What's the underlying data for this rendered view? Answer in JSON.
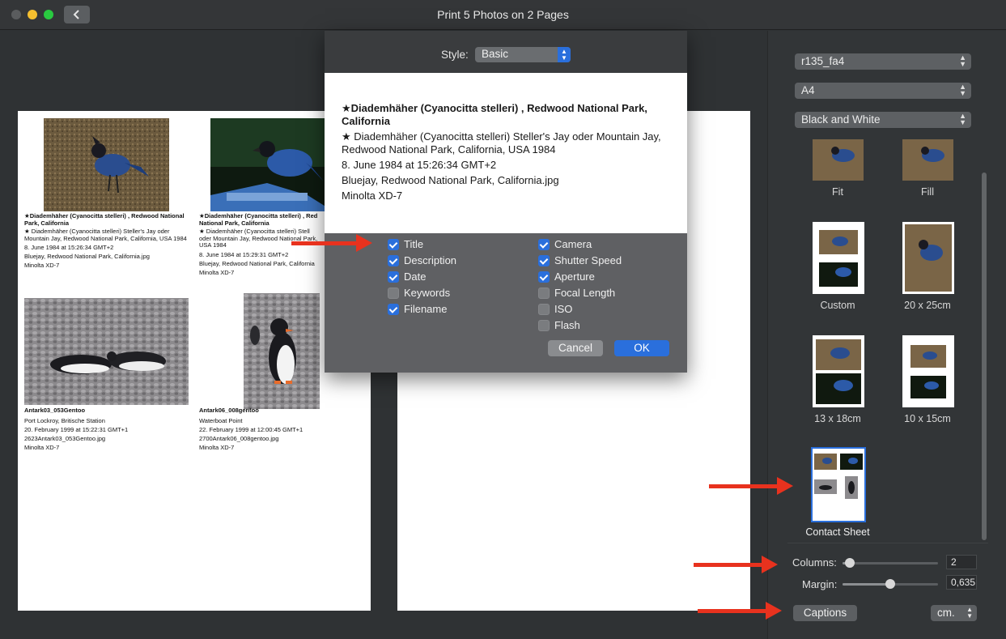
{
  "window": {
    "title": "Print 5 Photos on 2 Pages"
  },
  "page1": {
    "captions": [
      {
        "title": "★Diademhäher (Cyanocitta stelleri) , Redwood National Park, California",
        "description": "★ Diademhäher (Cyanocitta stelleri)  Steller's Jay oder Mountain Jay, Redwood National Park, California, USA 1984",
        "date": "8. June 1984 at 15:26:34 GMT+2",
        "filename": "Bluejay, Redwood National Park, California.jpg",
        "camera": "Minolta XD-7"
      },
      {
        "title": "★Diademhäher (Cyanocitta stelleri) , Red",
        "subtitle": "National Park, California",
        "description": "★ Diademhäher (Cyanocitta stelleri)  Stell",
        "description2": "oder Mountain Jay, Redwood National Park,",
        "description3": "USA 1984",
        "date": "8. June 1984 at 15:29:31 GMT+2",
        "filename": "Bluejay, Redwood National Park, California",
        "camera": "Minolta XD-7"
      },
      {
        "title": "Antark03_053Gentoo",
        "description": "Port Lockroy, Britische Station",
        "date": "20. February 1999 at 15:22:31 GMT+1",
        "filename": "2623Antark03_053Gentoo.jpg",
        "camera": "Minolta XD-7"
      },
      {
        "title": "Antark06_008gentoo",
        "description": "Waterboat Point",
        "date": "22. February 1999 at 12:00:45 GMT+1",
        "filename": "2700Antark06_008gentoo.jpg",
        "camera": "Minolta XD-7"
      }
    ]
  },
  "dialog": {
    "style_label": "Style:",
    "style_value": "Basic",
    "preview": {
      "title": "★Diademhäher (Cyanocitta stelleri) , Redwood National Park, California",
      "description": "★ Diademhäher (Cyanocitta stelleri)  Steller's Jay oder Mountain Jay, Redwood National Park, California, USA 1984",
      "date": "8. June 1984 at 15:26:34 GMT+2",
      "filename": "Bluejay, Redwood National Park, California.jpg",
      "camera": "Minolta XD-7"
    },
    "left_options": [
      {
        "label": "Title",
        "checked": true
      },
      {
        "label": "Description",
        "checked": true
      },
      {
        "label": "Date",
        "checked": true
      },
      {
        "label": "Keywords",
        "checked": false
      },
      {
        "label": "Filename",
        "checked": true
      }
    ],
    "right_options": [
      {
        "label": "Camera",
        "checked": true
      },
      {
        "label": "Shutter Speed",
        "checked": true
      },
      {
        "label": "Aperture",
        "checked": true
      },
      {
        "label": "Focal Length",
        "checked": false
      },
      {
        "label": "ISO",
        "checked": false
      },
      {
        "label": "Flash",
        "checked": false
      }
    ],
    "cancel_label": "Cancel",
    "ok_label": "OK"
  },
  "sidebar": {
    "printer": "r135_fa4",
    "paper": "A4",
    "color_mode": "Black and White",
    "layouts": [
      "Fit",
      "Fill",
      "Custom",
      "20 x 25cm",
      "13 x 18cm",
      "10 x 15cm",
      "Contact Sheet"
    ],
    "selected_layout": "Contact Sheet",
    "columns_label": "Columns:",
    "columns_value": "2",
    "columns_level": 0.08,
    "margin_label": "Margin:",
    "margin_value": "0,635",
    "margin_level": 0.5,
    "captions_label": "Captions",
    "units_value": "cm.",
    "colors": {
      "selected_border": "#2a6fdc",
      "arrow": "#e8321e",
      "accent": "#2a6fdc"
    }
  }
}
